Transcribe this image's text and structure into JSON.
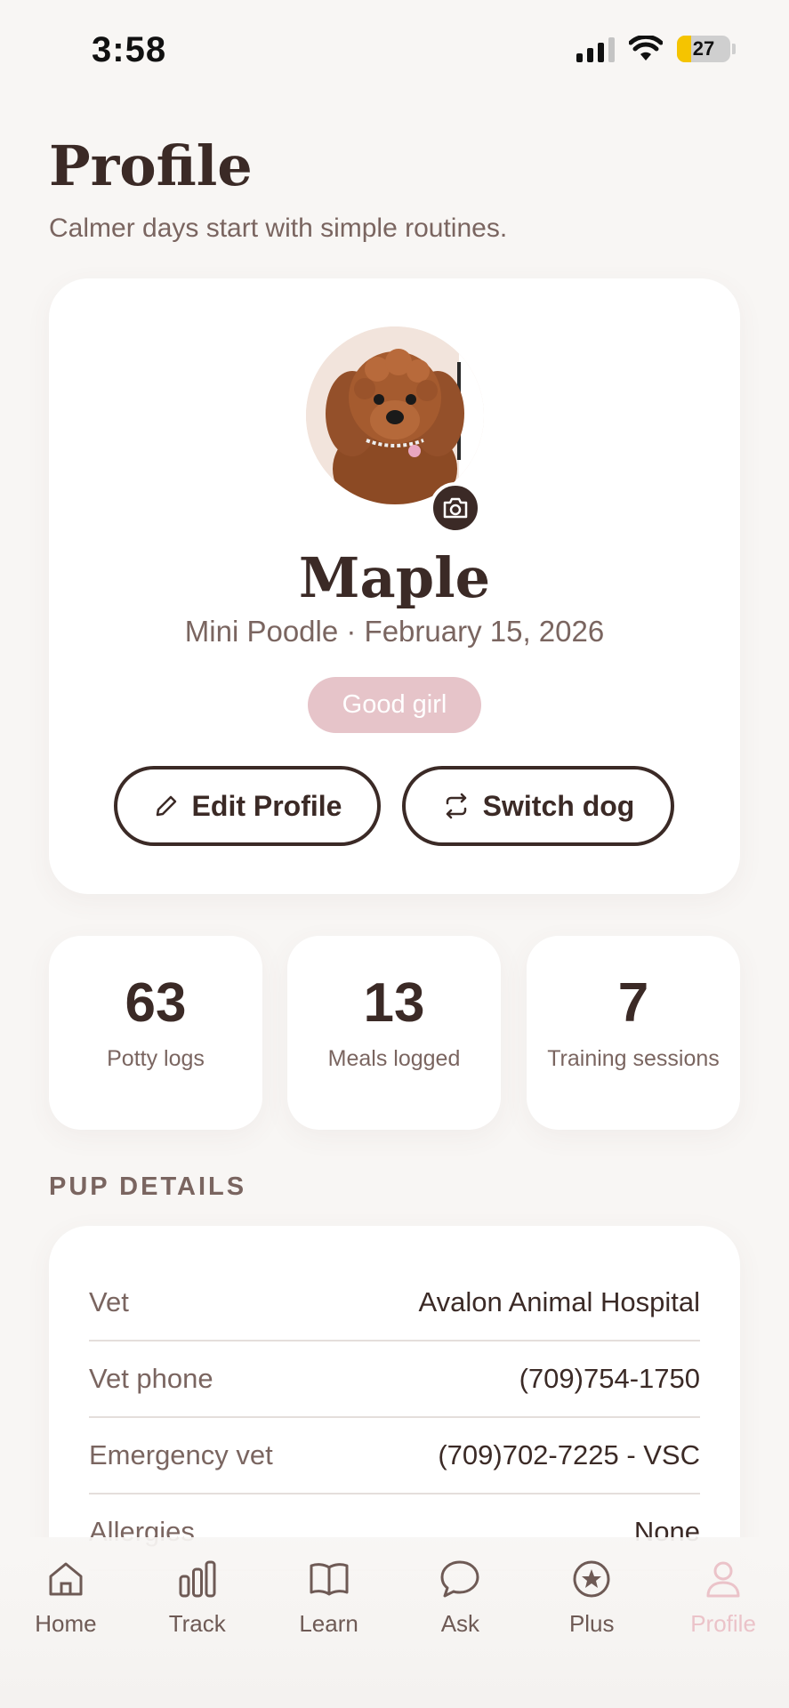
{
  "status_bar": {
    "time": "3:58",
    "battery": "27"
  },
  "header": {
    "title": "Profile",
    "subtitle": "Calmer days start with simple routines."
  },
  "profile": {
    "name": "Maple",
    "meta": "Mini Poodle · February 15, 2026",
    "badge": "Good girl",
    "edit_label": "Edit Profile",
    "switch_label": "Switch dog"
  },
  "stats": [
    {
      "value": "63",
      "label": "Potty logs"
    },
    {
      "value": "13",
      "label": "Meals logged"
    },
    {
      "value": "7",
      "label": "Training sessions"
    }
  ],
  "details": {
    "section_label": "PUP DETAILS",
    "rows": [
      {
        "key": "Vet",
        "value": "Avalon Animal Hospital"
      },
      {
        "key": "Vet phone",
        "value": "(709)754-1750"
      },
      {
        "key": "Emergency vet",
        "value": "(709)702-7225 - VSC"
      },
      {
        "key": "Allergies",
        "value": "None"
      }
    ]
  },
  "tabs": [
    {
      "label": "Home",
      "icon": "home-icon"
    },
    {
      "label": "Track",
      "icon": "bar-chart-icon"
    },
    {
      "label": "Learn",
      "icon": "book-icon"
    },
    {
      "label": "Ask",
      "icon": "chat-bubble-icon"
    },
    {
      "label": "Plus",
      "icon": "star-circle-icon"
    },
    {
      "label": "Profile",
      "icon": "person-icon",
      "active": true
    }
  ],
  "colors": {
    "text_primary": "#3b2a26",
    "text_secondary": "#7a6560",
    "background": "#f8f6f4",
    "badge_pink": "#e6c4c9",
    "active_tab": "#ebc3c9",
    "battery_low": "#f5c400"
  }
}
